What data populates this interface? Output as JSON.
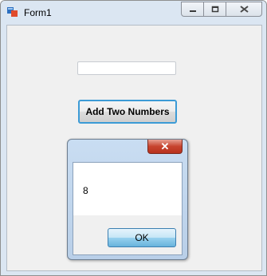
{
  "window": {
    "title": "Form1"
  },
  "form": {
    "input_value": "",
    "button_label": "Add Two Numbers"
  },
  "dialog": {
    "close_glyph": "✕",
    "message": "8",
    "ok_label": "OK"
  }
}
